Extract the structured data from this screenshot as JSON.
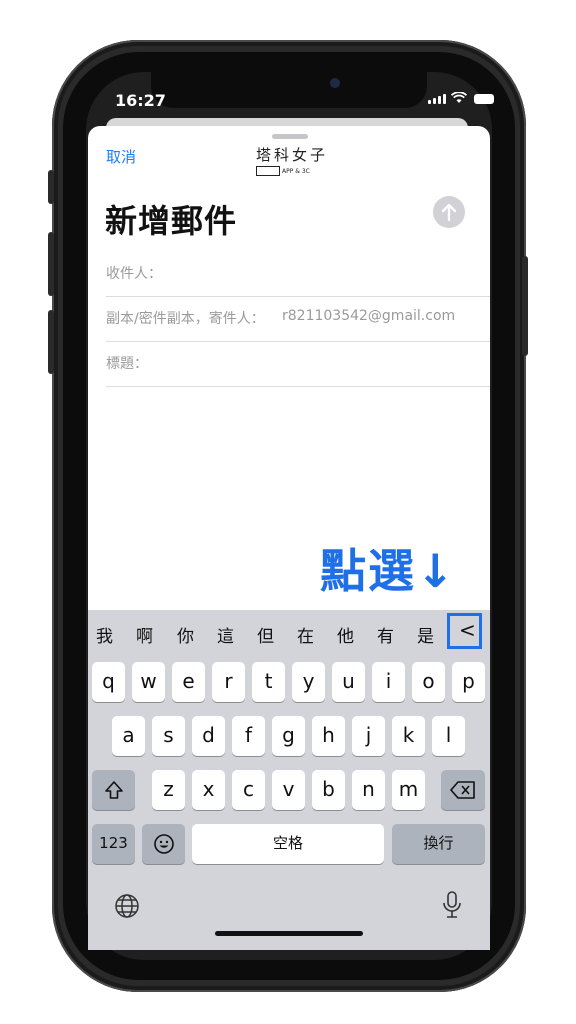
{
  "status": {
    "time": "16:27"
  },
  "compose": {
    "cancel_label": "取消",
    "logo_text": "塔科女子",
    "logo_subtext": "APP & 3C",
    "title": "新增郵件",
    "to_label": "收件人：",
    "cc_label": "副本/密件副本，寄件人：",
    "from_email": "r821103542@gmail.com",
    "subject_label": "標題："
  },
  "annotation": {
    "callout": "點選↓"
  },
  "keyboard": {
    "candidates": [
      "我",
      "啊",
      "你",
      "這",
      "但",
      "在",
      "他",
      "有",
      "是"
    ],
    "expand_glyph": "<",
    "row1": [
      "q",
      "w",
      "e",
      "r",
      "t",
      "y",
      "u",
      "i",
      "o",
      "p"
    ],
    "row2": [
      "a",
      "s",
      "d",
      "f",
      "g",
      "h",
      "j",
      "k",
      "l"
    ],
    "row3": [
      "z",
      "x",
      "c",
      "v",
      "b",
      "n",
      "m"
    ],
    "numbers_label": "123",
    "space_label": "空格",
    "return_label": "換行"
  },
  "colors": {
    "accent": "#1a7ff3",
    "callout": "#1f6fe6",
    "highlight_box": "#1f6fe6"
  }
}
